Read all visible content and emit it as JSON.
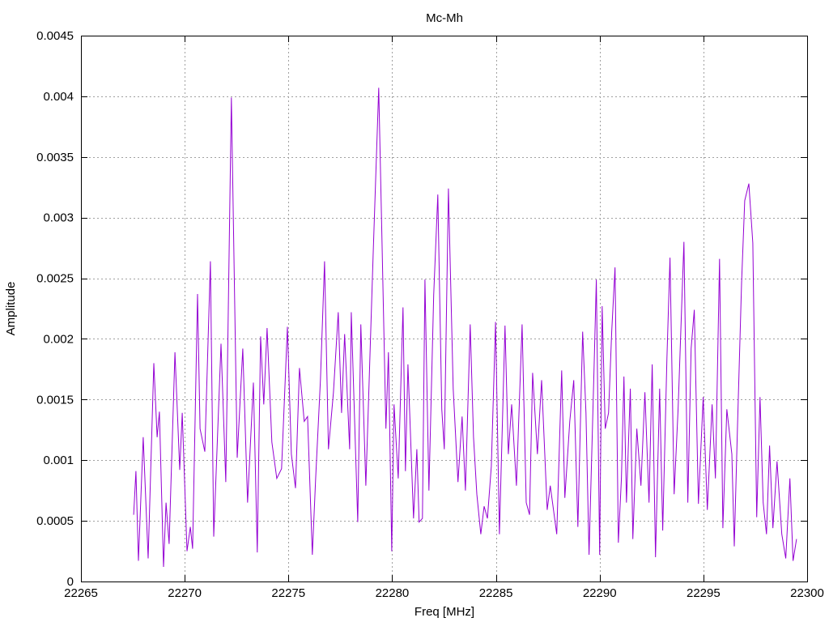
{
  "chart_data": {
    "type": "line",
    "title": "Mc-Mh",
    "xlabel": "Freq [MHz]",
    "ylabel": "Amplitude",
    "xlim": [
      22265,
      22300
    ],
    "ylim": [
      0,
      0.0045
    ],
    "grid": true,
    "legend": "none",
    "xticks": [
      "22265",
      "22270",
      "22275",
      "22280",
      "22285",
      "22290",
      "22295",
      "22300"
    ],
    "xtick_values": [
      22265,
      22270,
      22275,
      22280,
      22285,
      22290,
      22295,
      22300
    ],
    "yticks": [
      "0",
      "0.0005",
      "0.001",
      "0.0015",
      "0.002",
      "0.0025",
      "0.003",
      "0.0035",
      "0.004",
      "0.0045"
    ],
    "ytick_values": [
      0,
      0.0005,
      0.001,
      0.0015,
      0.002,
      0.0025,
      0.003,
      0.0035,
      0.004,
      0.0045
    ],
    "series": [
      {
        "name": "Mc-Mh",
        "color": "#9400d3",
        "x": [
          22267.54,
          22267.65,
          22267.77,
          22268.0,
          22268.24,
          22268.51,
          22268.67,
          22268.78,
          22268.98,
          22269.1,
          22269.25,
          22269.53,
          22269.76,
          22269.88,
          22270.11,
          22270.27,
          22270.38,
          22270.62,
          22270.74,
          22270.97,
          22271.24,
          22271.4,
          22271.75,
          22271.98,
          22272.25,
          22272.53,
          22272.8,
          22273.03,
          22273.31,
          22273.5,
          22273.66,
          22273.81,
          22273.97,
          22274.2,
          22274.44,
          22274.67,
          22274.95,
          22275.14,
          22275.34,
          22275.53,
          22275.76,
          22275.92,
          22276.15,
          22276.31,
          22276.54,
          22276.74,
          22276.93,
          22277.17,
          22277.4,
          22277.56,
          22277.71,
          22277.95,
          22278.03,
          22278.34,
          22278.49,
          22278.73,
          22279.08,
          22279.35,
          22279.51,
          22279.7,
          22279.82,
          22279.98,
          22280.09,
          22280.29,
          22280.52,
          22280.64,
          22280.76,
          22281.03,
          22281.19,
          22281.3,
          22281.46,
          22281.58,
          22281.77,
          22282.0,
          22282.2,
          22282.39,
          22282.51,
          22282.71,
          22282.94,
          22283.17,
          22283.37,
          22283.53,
          22283.76,
          22283.92,
          22284.08,
          22284.27,
          22284.43,
          22284.59,
          22284.78,
          22284.98,
          22285.17,
          22285.44,
          22285.6,
          22285.76,
          22285.99,
          22286.26,
          22286.46,
          22286.62,
          22286.77,
          22287.0,
          22287.2,
          22287.47,
          22287.62,
          22287.93,
          22288.17,
          22288.32,
          22288.56,
          22288.75,
          22288.95,
          22289.18,
          22289.34,
          22289.49,
          22289.73,
          22289.84,
          22290.0,
          22290.12,
          22290.27,
          22290.43,
          22290.58,
          22290.74,
          22290.9,
          22291.05,
          22291.17,
          22291.29,
          22291.48,
          22291.6,
          22291.79,
          22291.99,
          22292.18,
          22292.38,
          22292.53,
          22292.69,
          22292.89,
          22293.04,
          22293.24,
          22293.39,
          22293.59,
          22293.78,
          22294.06,
          22294.25,
          22294.41,
          22294.56,
          22294.76,
          22294.99,
          22295.19,
          22295.42,
          22295.58,
          22295.78,
          22295.94,
          22296.13,
          22296.37,
          22296.49,
          22296.64,
          22296.84,
          22296.99,
          22297.19,
          22297.38,
          22297.57,
          22297.73,
          22297.88,
          22298.04,
          22298.19,
          22298.35,
          22298.55,
          22298.78,
          22298.97,
          22299.17,
          22299.32,
          22299.49
        ],
        "y": [
          0.00055,
          0.00091,
          0.00017,
          0.00119,
          0.00019,
          0.0018,
          0.00119,
          0.0014,
          0.00012,
          0.00065,
          0.00031,
          0.00189,
          0.00092,
          0.00139,
          0.00025,
          0.00045,
          0.00027,
          0.00237,
          0.00126,
          0.00107,
          0.00264,
          0.00037,
          0.00196,
          0.00082,
          0.00399,
          0.00102,
          0.00192,
          0.00065,
          0.00164,
          0.00024,
          0.00202,
          0.00146,
          0.00209,
          0.00115,
          0.00085,
          0.00093,
          0.0021,
          0.00105,
          0.00077,
          0.00176,
          0.00132,
          0.00136,
          0.00022,
          0.00085,
          0.00166,
          0.00264,
          0.00109,
          0.00156,
          0.00222,
          0.00139,
          0.00204,
          0.00109,
          0.00222,
          0.00049,
          0.00212,
          0.00079,
          0.00269,
          0.00407,
          0.00279,
          0.00126,
          0.00189,
          0.00025,
          0.00146,
          0.00085,
          0.00226,
          0.00091,
          0.00179,
          0.00052,
          0.00109,
          0.00049,
          0.00052,
          0.00249,
          0.00075,
          0.00236,
          0.00319,
          0.00142,
          0.00109,
          0.00324,
          0.00159,
          0.00082,
          0.00136,
          0.00075,
          0.00212,
          0.00119,
          0.00072,
          0.00039,
          0.00062,
          0.00052,
          0.00095,
          0.00214,
          0.00039,
          0.00211,
          0.00105,
          0.00146,
          0.00079,
          0.00212,
          0.00065,
          0.00055,
          0.00172,
          0.00105,
          0.00166,
          0.00059,
          0.00079,
          0.00039,
          0.00174,
          0.00069,
          0.00132,
          0.00166,
          0.00045,
          0.00206,
          0.00139,
          0.00022,
          0.00176,
          0.00249,
          0.00022,
          0.00227,
          0.00126,
          0.00139,
          0.00206,
          0.00259,
          0.00032,
          0.00085,
          0.00169,
          0.00065,
          0.00159,
          0.00035,
          0.00126,
          0.00079,
          0.00156,
          0.00065,
          0.00179,
          0.0002,
          0.00159,
          0.00042,
          0.00184,
          0.00267,
          0.00072,
          0.00142,
          0.0028,
          0.00065,
          0.00192,
          0.00224,
          0.00064,
          0.00152,
          0.00059,
          0.00146,
          0.00085,
          0.00266,
          0.00044,
          0.00142,
          0.00105,
          0.00029,
          0.00126,
          0.00246,
          0.00314,
          0.00328,
          0.00279,
          0.00053,
          0.00152,
          0.00065,
          0.00039,
          0.00112,
          0.00044,
          0.00099,
          0.00039,
          0.00019,
          0.00085,
          0.00017,
          0.00035
        ]
      }
    ]
  }
}
